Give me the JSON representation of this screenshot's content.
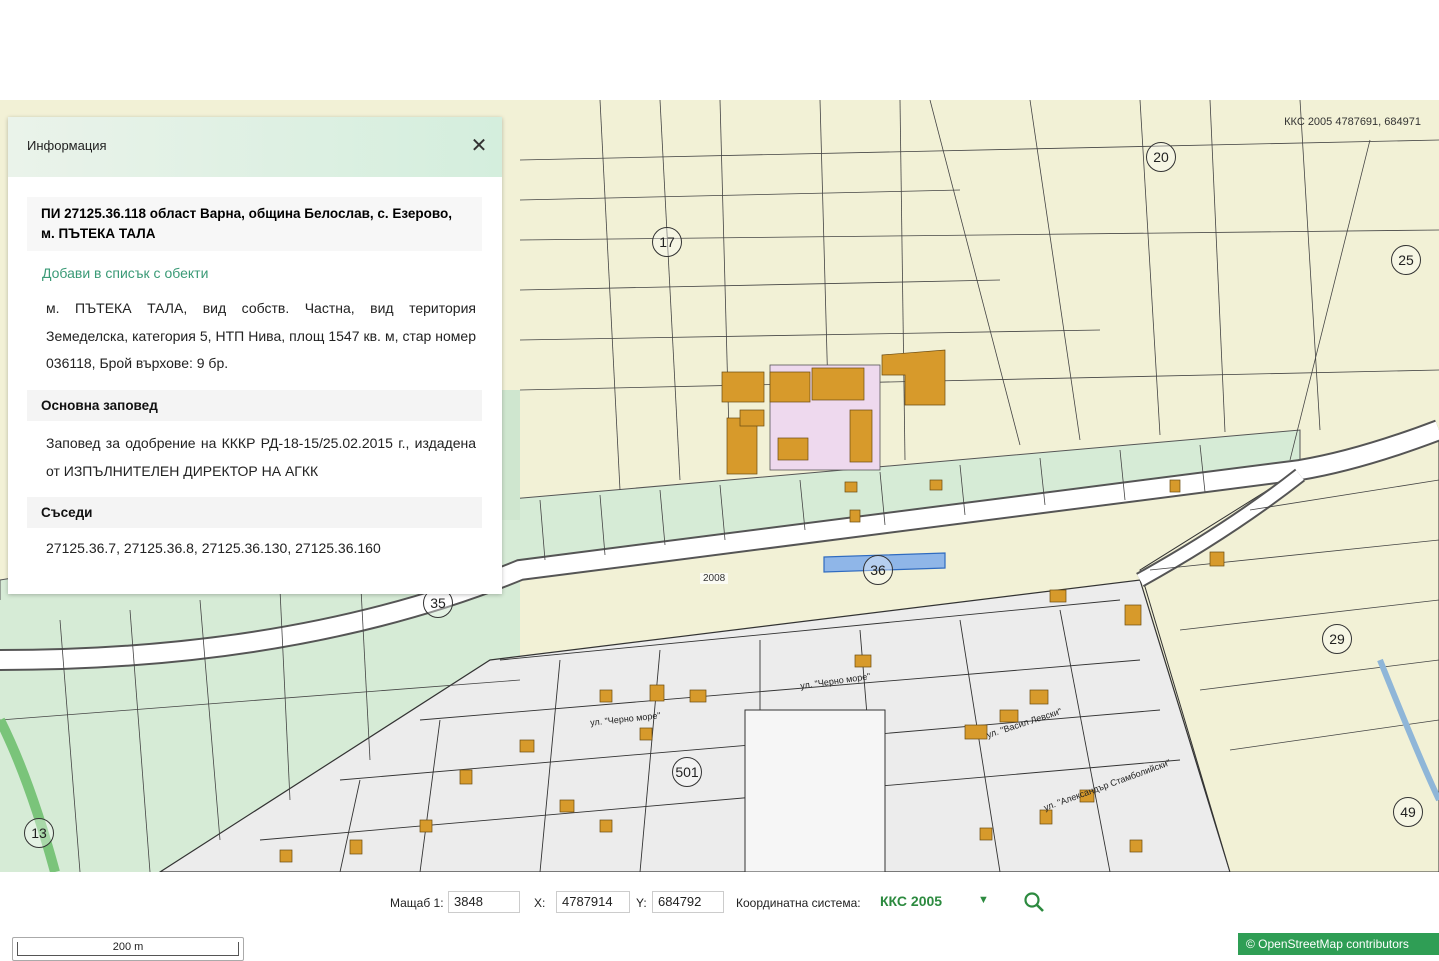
{
  "map": {
    "coord_readout": "ККС 2005 4787691, 684971",
    "parcel_labels": [
      "20",
      "17",
      "25",
      "36",
      "35",
      "29",
      "501",
      "13",
      "49"
    ],
    "road_label": "2008",
    "street_labels": [
      "ул. \"Черно море\"",
      "ул. \"Васил Левски\"",
      "ул. \"Александър Стамболийски\"",
      "ул. \"Черно море\""
    ],
    "highlight_color": "#8fb6e8",
    "colors": {
      "agri": "#f2f1d6",
      "forest": "#d6ebd6",
      "urban": "#ececec",
      "building": "#d79a2b",
      "pink": "#eed9ee"
    }
  },
  "info": {
    "title": "Информация",
    "close_icon": "✕",
    "parcel_title": "ПИ 27125.36.118 област Варна, община Белослав, с. Езерово, м. ПЪТЕКА ТАЛА",
    "add_link": "Добави в списък с обекти",
    "description": "м. ПЪТЕКА ТАЛА, вид собств. Частна, вид територия Земеделска, категория 5, НТП Нива, площ 1547 кв. м, стар номер 036118, Брой върхове: 9 бр.",
    "order_heading": "Основна заповед",
    "order_text": "Заповед за одобрение на КККР РД-18-15/25.02.2015 г., издадена от ИЗПЪЛНИТЕЛЕН ДИРЕКТОР НА АГКК",
    "neighbours_heading": "Съседи",
    "neighbours_text": "27125.36.7, 27125.36.8, 27125.36.130, 27125.36.160"
  },
  "coord_bar": {
    "scale_label": "Мащаб 1:",
    "scale_value": "3848",
    "x_label": "X:",
    "x_value": "4787914",
    "y_label": "Y:",
    "y_value": "684792",
    "crs_label": "Координатна система:",
    "crs_value": "ККС 2005",
    "crs_arrow": "▼"
  },
  "scale_bar": {
    "label": "200 m"
  },
  "attribution": "© OpenStreetMap contributors"
}
